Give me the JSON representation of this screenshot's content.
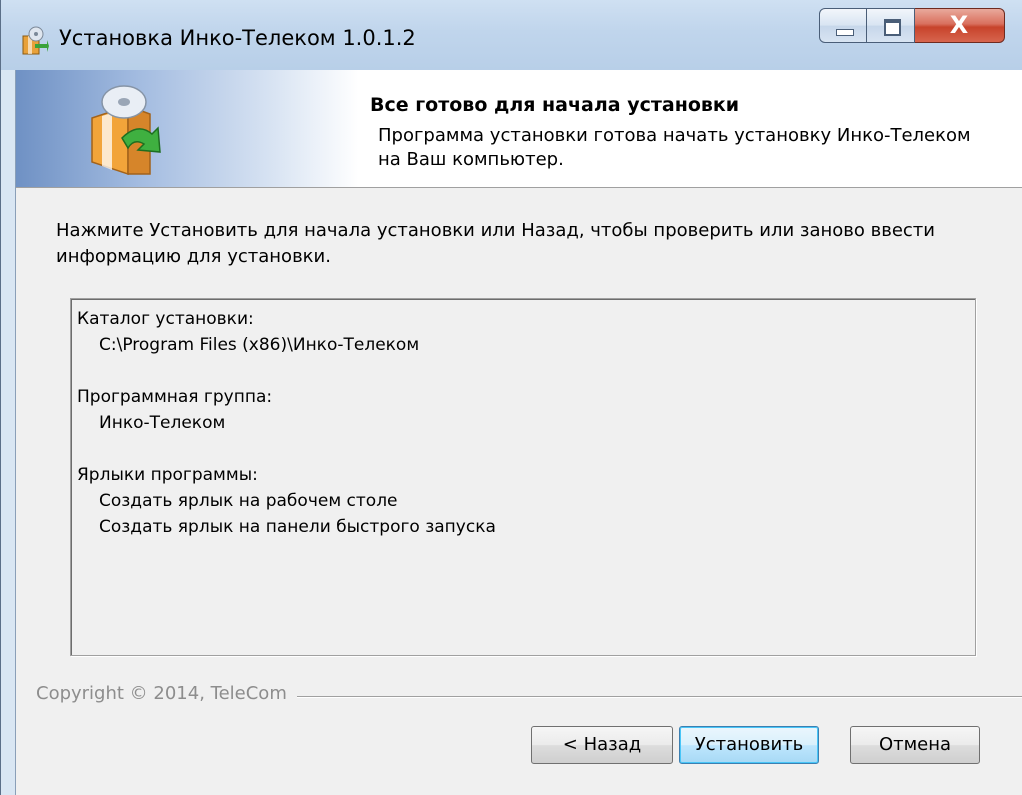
{
  "window": {
    "title": "Установка Инко-Телеком 1.0.1.2",
    "controls": [
      "minimize-icon",
      "maximize-icon",
      "close-icon"
    ],
    "close_glyph": "X"
  },
  "header": {
    "title": "Все готово для начала установки",
    "description": "Программа установки готова начать установку Инко-Телеком на Ваш компьютер.",
    "icon": "installer-box-icon"
  },
  "instruction": "Нажмите Установить для начала установки или Назад, чтобы проверить или заново ввести информацию для установки.",
  "summary": {
    "lines": [
      {
        "text": "Каталог установки:",
        "indent": 0
      },
      {
        "text": "C:\\Program Files (x86)\\Инко-Телеком",
        "indent": 1
      },
      {
        "text": "Программная группа:",
        "indent": 0
      },
      {
        "text": "Инко-Телеком",
        "indent": 1
      },
      {
        "text": "Ярлыки программы:",
        "indent": 0
      },
      {
        "text": "Создать ярлык на рабочем столе",
        "indent": 1
      },
      {
        "text": "Создать ярлык на панели быстрого запуска",
        "indent": 1
      }
    ]
  },
  "footer": {
    "copyright": "Copyright © 2014, TeleCom",
    "buttons": {
      "back": "< Назад",
      "install": "Установить",
      "cancel": "Отмена"
    }
  },
  "colors": {
    "title_bar": "#c0d5ec",
    "close_button": "#c7432b",
    "client_bg": "#f0f0f0",
    "header_gradient_start": "#6f91c4",
    "default_button_border": "#3c7fb1"
  }
}
